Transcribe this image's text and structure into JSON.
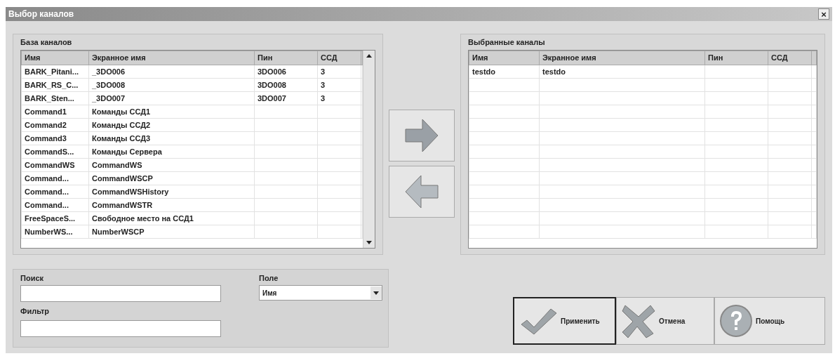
{
  "window": {
    "title": "Выбор каналов",
    "close": "×"
  },
  "channel_base": {
    "label": "База каналов",
    "columns": [
      "Имя",
      "Экранное имя",
      "Пин",
      "ССД"
    ],
    "rows": [
      [
        "BARK_Pitani...",
        "_3DO006",
        "3DO006",
        "3"
      ],
      [
        "BARK_RS_C...",
        "_3DO008",
        "3DO008",
        "3"
      ],
      [
        "BARK_Sten...",
        "_3DO007",
        "3DO007",
        "3"
      ],
      [
        "Command1",
        "Команды ССД1",
        "",
        ""
      ],
      [
        "Command2",
        "Команды ССД2",
        "",
        ""
      ],
      [
        "Command3",
        "Команды ССД3",
        "",
        ""
      ],
      [
        "CommandS...",
        "Команды Сервера",
        "",
        ""
      ],
      [
        "CommandWS",
        "CommandWS",
        "",
        ""
      ],
      [
        "Command...",
        "CommandWSCP",
        "",
        ""
      ],
      [
        "Command...",
        "CommandWSHistory",
        "",
        ""
      ],
      [
        "Command...",
        "CommandWSTR",
        "",
        ""
      ],
      [
        "FreeSpaceS...",
        "Свободное место на ССД1",
        "",
        ""
      ],
      [
        "NumberWS...",
        "NumberWSCP",
        "",
        ""
      ]
    ]
  },
  "selected_channels": {
    "label": "Выбранные каналы",
    "columns": [
      "Имя",
      "Экранное имя",
      "Пин",
      "ССД"
    ],
    "rows": [
      [
        "testdo",
        "testdo",
        "",
        ""
      ]
    ]
  },
  "search": {
    "label": "Поиск"
  },
  "field": {
    "label": "Поле",
    "value": "Имя"
  },
  "filter": {
    "label": "Фильтр"
  },
  "buttons": [
    {
      "kind": "apply",
      "label": "Применить",
      "selected": true
    },
    {
      "kind": "cancel",
      "label": "Отмена",
      "selected": false
    },
    {
      "kind": "help",
      "label": "Помощь",
      "selected": false
    }
  ]
}
